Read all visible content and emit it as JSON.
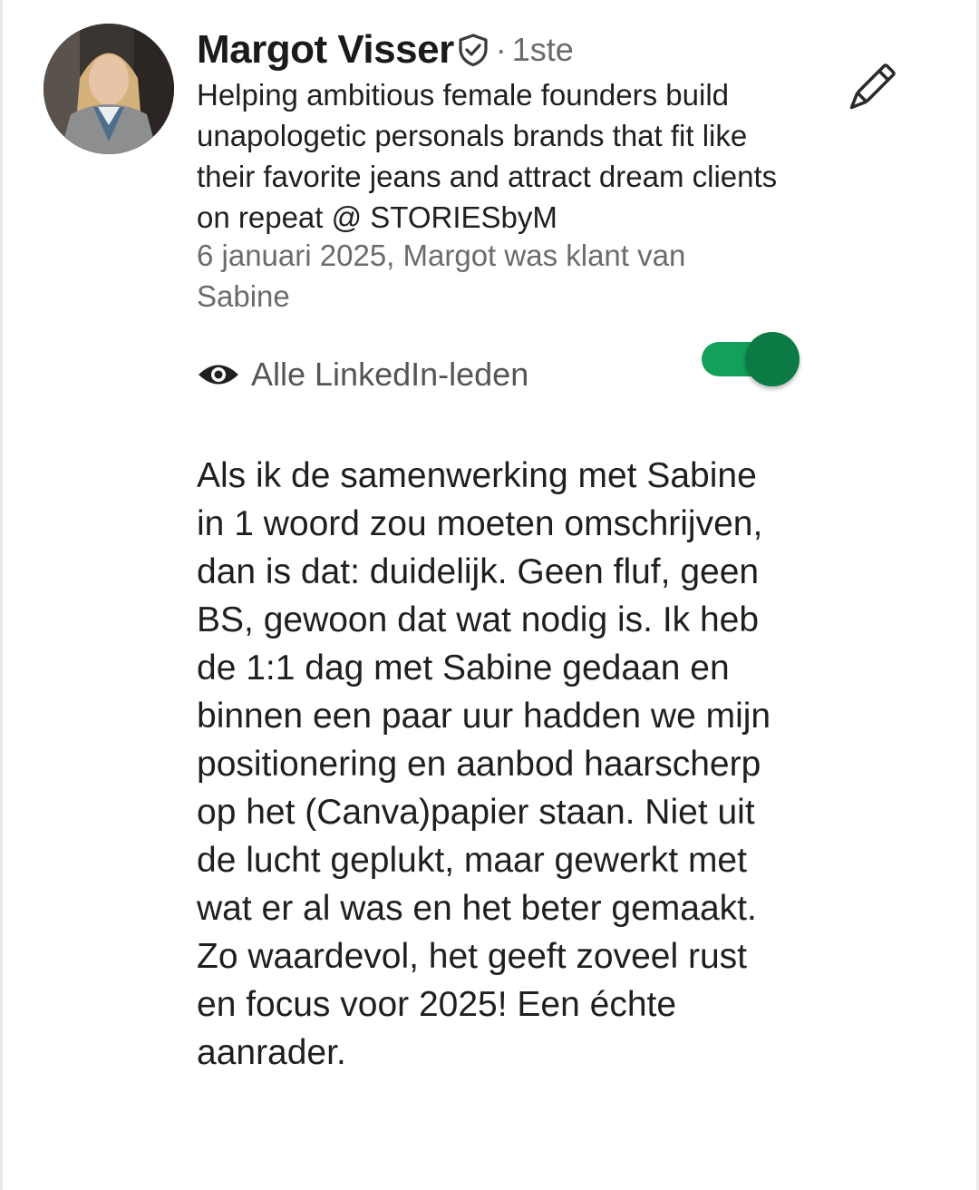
{
  "recommendation": {
    "author_name": "Margot Visser",
    "degree_separator": "·",
    "connection_degree": "1ste",
    "headline": "Helping ambitious female founders build unapologetic personals brands that fit like their favorite jeans and attract dream clients on repeat @ STORIESbyM",
    "meta": "6 januari 2025, Margot was klant van Sabine",
    "visibility_label": "Alle LinkedIn-leden",
    "visibility_enabled": true,
    "body": "Als ik de samenwerking met Sabine in 1 woord zou moeten omschrijven, dan is dat: duidelijk. Geen fluf, geen BS, gewoon dat wat nodig is. Ik heb de 1:1 dag met Sabine gedaan en binnen een paar uur hadden we mijn positionering en aanbod haarscherp op het (Canva)papier staan. Niet uit de lucht geplukt, maar gewerkt met wat er al was en het beter gemaakt. Zo waardevol, het geeft zoveel rust en focus voor 2025! Een échte aanrader."
  },
  "icons": {
    "verified": "verified-shield-icon",
    "edit": "pencil-icon",
    "visibility": "eye-icon"
  },
  "colors": {
    "toggle_track": "#12a05a",
    "toggle_knob": "#0b7a44",
    "secondary_text": "#6b6b6b",
    "primary_text": "#1f1f1f"
  }
}
